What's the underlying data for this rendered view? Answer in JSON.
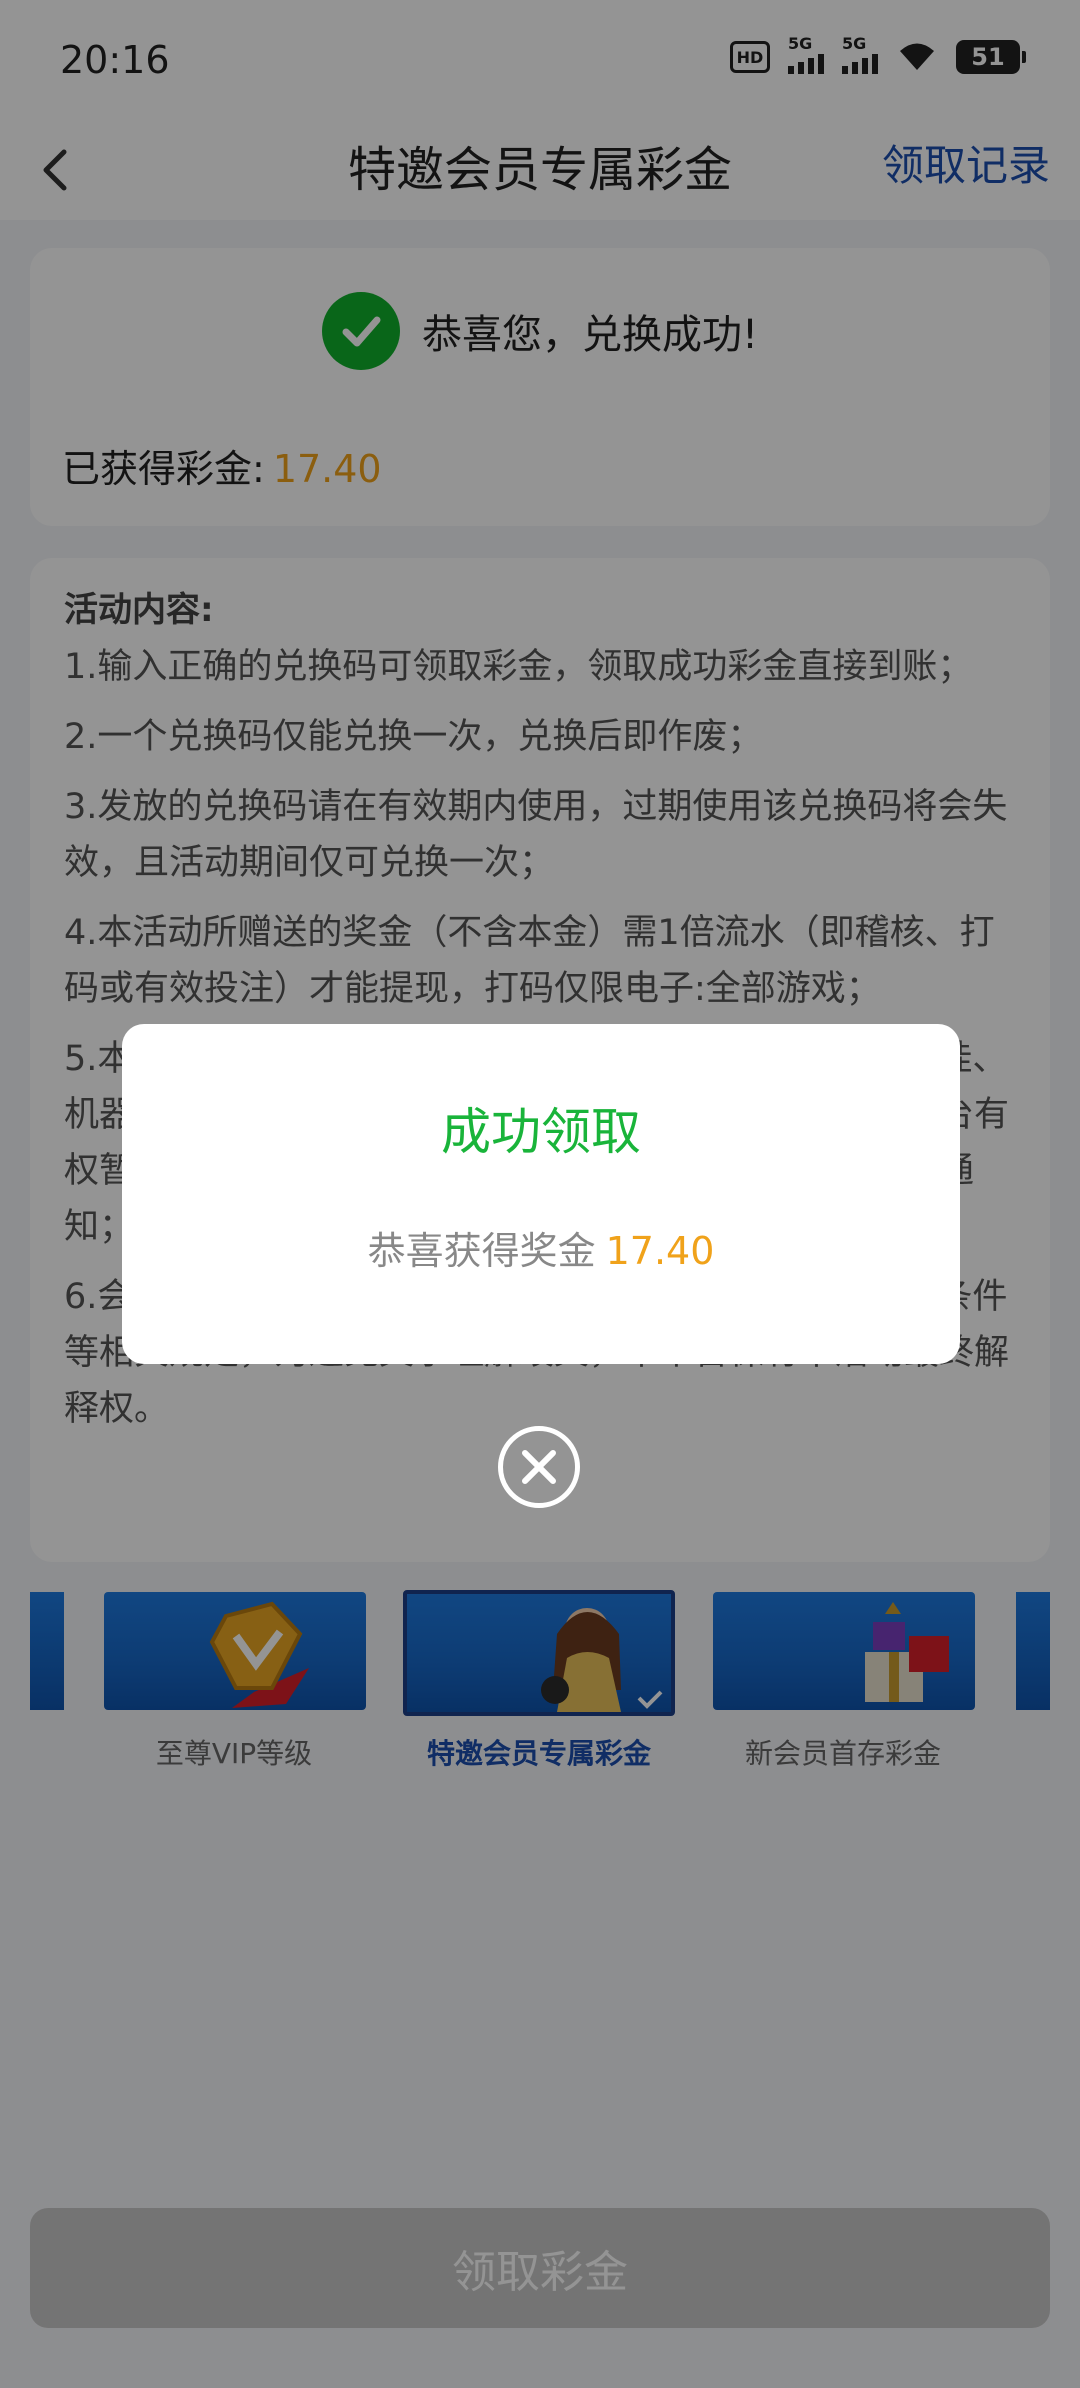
{
  "status_bar": {
    "time": "20:16",
    "hd_label": "HD",
    "signal1_label": "5G",
    "signal2_label": "5G",
    "battery": "51"
  },
  "navbar": {
    "title": "特邀会员专属彩金",
    "action": "领取记录"
  },
  "success_card": {
    "message": "恭喜您，兑换成功!",
    "earned_label": "已获得彩金:",
    "earned_amount": "17.40"
  },
  "rules": {
    "title": "活动内容:",
    "items": [
      "1.输入正确的兑换码可领取彩金，领取成功彩金直接到账；",
      "2.一个兑换码仅能兑换一次，兑换后即作废；",
      "3.发放的兑换码请在有效期内使用，过期使用该兑换码将会失效，且活动期间仅可兑换一次；",
      "4.本活动所赠送的奖金（不含本金）需1倍流水（即稽核、打码或有效投注）才能提现，打码仅限电子:全部游戏；",
      "5.本活动仅限账号本人进行正常游戏，禁止套利、使用外挂、机器人或利用漏洞、技术手段等方式参与活动，违规者平台有权暂停会员账号并取消奖励，如有异常，平台将另行识别通知；",
      "6.会员参与该活动时，本平台将默认会员同意且遵守对应条件等相关规定，为避免文字理解歧义，本平台保有本活动最终解释权。"
    ]
  },
  "promos": [
    {
      "label": "至尊VIP等级",
      "selected": false
    },
    {
      "label": "特邀会员专属彩金",
      "selected": true
    },
    {
      "label": "新会员首存彩金",
      "selected": false
    }
  ],
  "main_button": {
    "label": "领取彩金"
  },
  "modal": {
    "title": "成功领取",
    "body_label": "恭喜获得奖金",
    "amount": "17.40"
  },
  "colors": {
    "accent_blue": "#1c4fae",
    "success_green": "#19b43a",
    "amount_orange": "#f0a21a",
    "check_green": "#10b02b"
  }
}
